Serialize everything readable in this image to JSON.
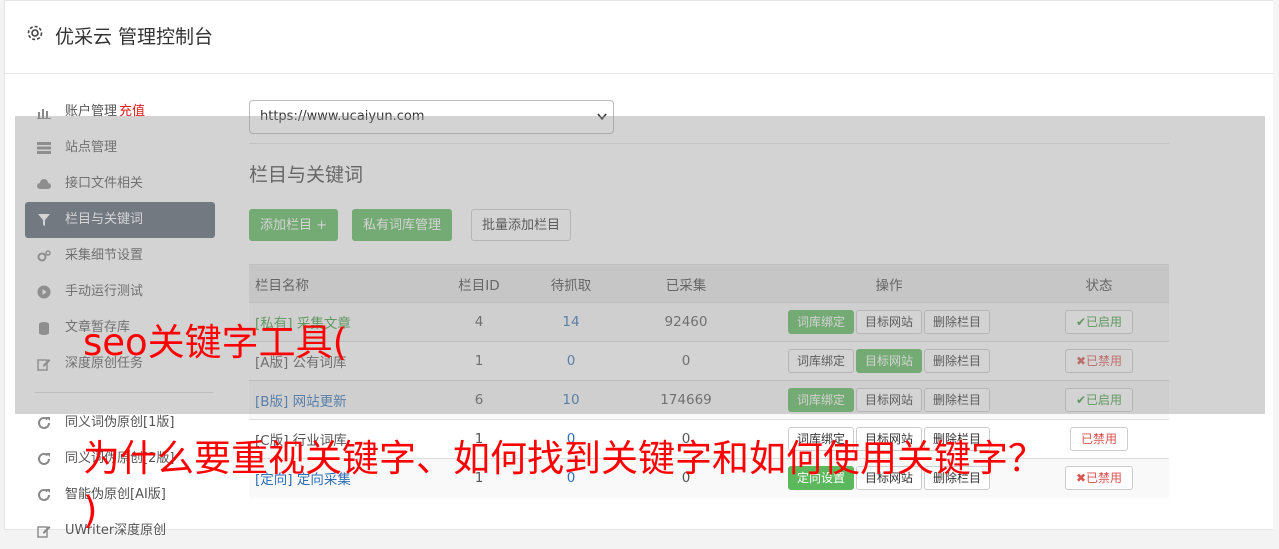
{
  "header": {
    "title": "优采云 管理控制台"
  },
  "sidebar": {
    "items": [
      {
        "label": "账户管理",
        "extra": "充值",
        "icon": "bar-chart-icon",
        "active": false
      },
      {
        "label": "站点管理",
        "icon": "server-icon",
        "active": false
      },
      {
        "label": "接口文件相关",
        "icon": "cloud-upload-icon",
        "active": false
      },
      {
        "label": "栏目与关键词",
        "icon": "filter-icon",
        "active": true
      },
      {
        "label": "采集细节设置",
        "icon": "cogs-icon",
        "active": false
      },
      {
        "label": "手动运行测试",
        "icon": "play-circle-icon",
        "active": false
      },
      {
        "label": "文章暂存库",
        "icon": "database-icon",
        "active": false
      },
      {
        "label": "深度原创任务",
        "icon": "edit-icon",
        "active": false
      }
    ],
    "items2": [
      {
        "label": "同义词伪原创[1版]",
        "icon": "refresh-icon"
      },
      {
        "label": "同义词伪原创[2版]",
        "icon": "refresh-icon"
      },
      {
        "label": "智能伪原创[AI版]",
        "icon": "refresh-icon"
      },
      {
        "label": "UWriter深度原创",
        "icon": "edit-icon"
      }
    ]
  },
  "main": {
    "site_select": "https://www.ucaiyun.com",
    "section_title": "栏目与关键词",
    "buttons": {
      "add": "添加栏目 +",
      "private": "私有词库管理",
      "batch": "批量添加栏目"
    },
    "table": {
      "headers": [
        "栏目名称",
        "栏目ID",
        "待抓取",
        "已采集",
        "操作",
        "状态"
      ],
      "op_labels": [
        "词库绑定",
        "目标网站",
        "删除栏目"
      ],
      "op_label_directed": "定向设置",
      "rows": [
        {
          "name": "[私有] 采集文章",
          "id": "4",
          "pending": "14",
          "collected": "92460",
          "status": "✔已启用"
        },
        {
          "name": "[A版] 公有词库",
          "id": "1",
          "pending": "0",
          "collected": "0",
          "status": "✖已禁用"
        },
        {
          "name": "[B版] 网站更新",
          "id": "6",
          "pending": "10",
          "collected": "174669",
          "status": "✔已启用"
        },
        {
          "name": "[C版] 行业词库",
          "id": "1",
          "pending": "0",
          "collected": "0",
          "status": "已禁用"
        },
        {
          "name": "[定向] 定向采集",
          "id": "1",
          "pending": "0",
          "collected": "0",
          "status": "✖已禁用"
        }
      ]
    }
  },
  "watermark": {
    "line1": "seo关键字工具(",
    "line2": "为什么要重视关键字、如何找到关键字和如何使用关键字？",
    "line3": ")"
  },
  "colors": {
    "primary": "#5cb85c",
    "active_nav": "#5b6573",
    "danger": "#d9534f",
    "link": "#2f6fb5"
  }
}
